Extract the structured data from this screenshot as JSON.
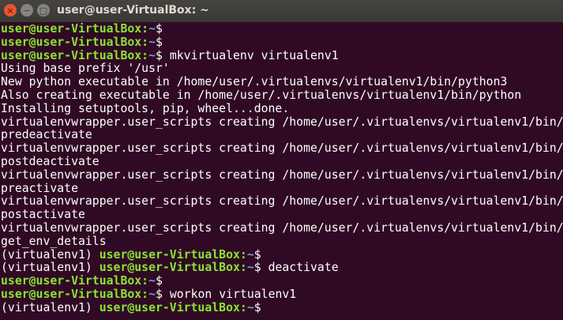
{
  "window": {
    "title": "user@user-VirtualBox: ~",
    "close_icon": "×",
    "minimize_icon": "−",
    "maximize_icon": "□"
  },
  "colors": {
    "background": "#300a24",
    "user": "#8ae234",
    "path": "#729fcf",
    "text": "#ffffff"
  },
  "lines": [
    {
      "pre": "",
      "user": "user@user-VirtualBox",
      "path": "~",
      "cmd": ""
    },
    {
      "pre": "",
      "user": "user@user-VirtualBox",
      "path": "~",
      "cmd": ""
    },
    {
      "pre": "",
      "user": "user@user-VirtualBox",
      "path": "~",
      "cmd": " mkvirtualenv virtualenv1"
    },
    {
      "text": "Using base prefix '/usr'"
    },
    {
      "text": "New python executable in /home/user/.virtualenvs/virtualenv1/bin/python3"
    },
    {
      "text": "Also creating executable in /home/user/.virtualenvs/virtualenv1/bin/python"
    },
    {
      "text": "Installing setuptools, pip, wheel...done."
    },
    {
      "text": "virtualenvwrapper.user_scripts creating /home/user/.virtualenvs/virtualenv1/bin/"
    },
    {
      "text": "predeactivate"
    },
    {
      "text": "virtualenvwrapper.user_scripts creating /home/user/.virtualenvs/virtualenv1/bin/"
    },
    {
      "text": "postdeactivate"
    },
    {
      "text": "virtualenvwrapper.user_scripts creating /home/user/.virtualenvs/virtualenv1/bin/"
    },
    {
      "text": "preactivate"
    },
    {
      "text": "virtualenvwrapper.user_scripts creating /home/user/.virtualenvs/virtualenv1/bin/"
    },
    {
      "text": "postactivate"
    },
    {
      "text": "virtualenvwrapper.user_scripts creating /home/user/.virtualenvs/virtualenv1/bin/"
    },
    {
      "text": "get_env_details"
    },
    {
      "pre": "(virtualenv1) ",
      "user": "user@user-VirtualBox",
      "path": "~",
      "cmd": ""
    },
    {
      "pre": "(virtualenv1) ",
      "user": "user@user-VirtualBox",
      "path": "~",
      "cmd": " deactivate"
    },
    {
      "pre": "",
      "user": "user@user-VirtualBox",
      "path": "~",
      "cmd": ""
    },
    {
      "pre": "",
      "user": "user@user-VirtualBox",
      "path": "~",
      "cmd": " workon virtualenv1"
    },
    {
      "pre": "(virtualenv1) ",
      "user": "user@user-VirtualBox",
      "path": "~",
      "cmd": ""
    }
  ]
}
